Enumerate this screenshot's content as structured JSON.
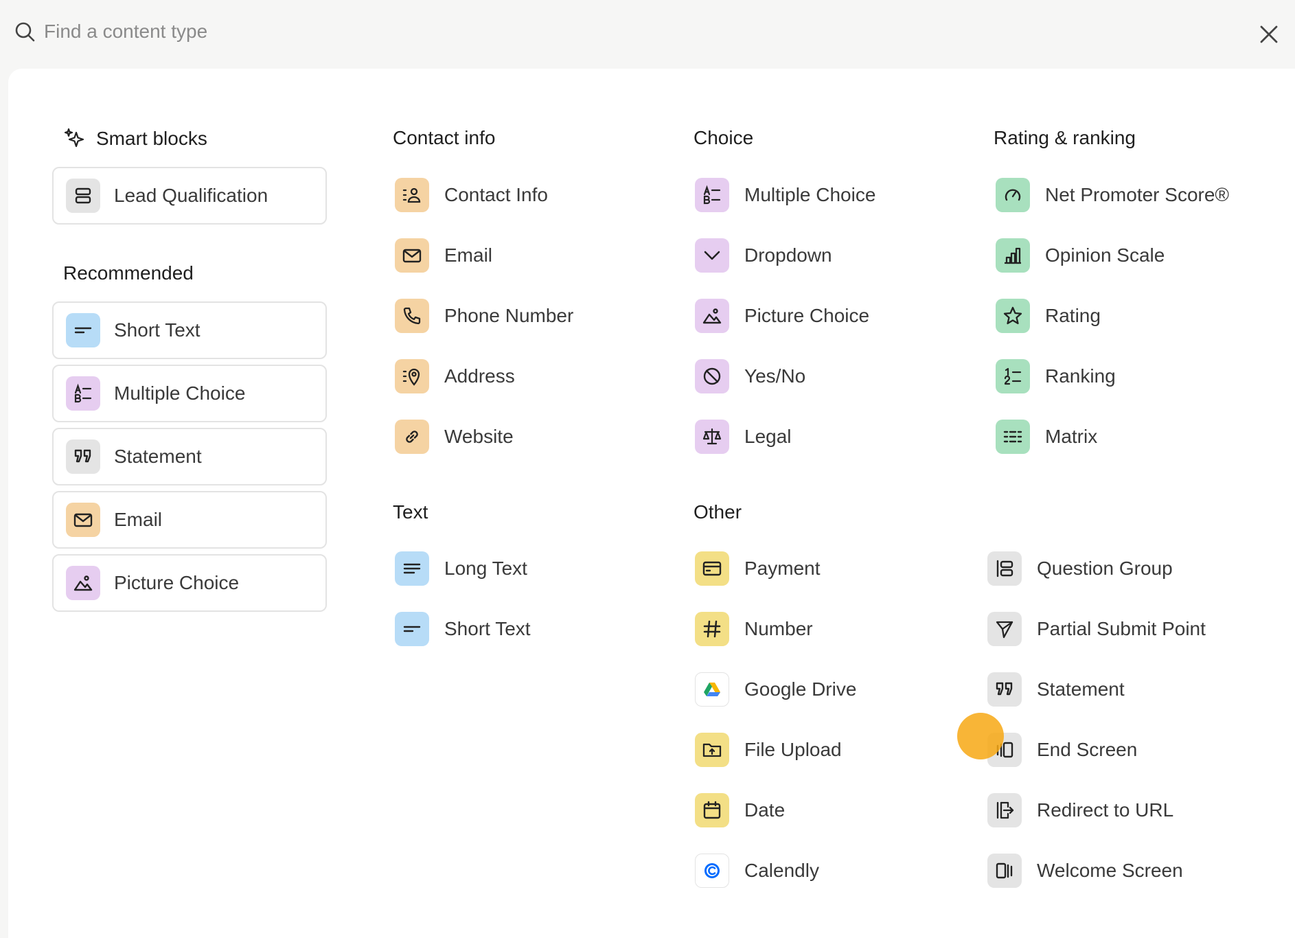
{
  "search": {
    "placeholder": "Find a content type"
  },
  "smart_blocks": {
    "heading": "Smart blocks",
    "items": [
      {
        "label": "Lead Qualification",
        "icon": "stack-icon"
      }
    ]
  },
  "recommended": {
    "heading": "Recommended",
    "items": [
      {
        "label": "Short Text",
        "icon": "short-text-icon"
      },
      {
        "label": "Multiple Choice",
        "icon": "multiple-choice-icon"
      },
      {
        "label": "Statement",
        "icon": "quote-icon"
      },
      {
        "label": "Email",
        "icon": "envelope-icon"
      },
      {
        "label": "Picture Choice",
        "icon": "picture-icon"
      }
    ]
  },
  "contact_info": {
    "heading": "Contact info",
    "items": [
      {
        "label": "Contact Info",
        "icon": "contact-card-icon"
      },
      {
        "label": "Email",
        "icon": "envelope-icon"
      },
      {
        "label": "Phone Number",
        "icon": "phone-icon"
      },
      {
        "label": "Address",
        "icon": "location-pin-icon"
      },
      {
        "label": "Website",
        "icon": "link-icon"
      }
    ]
  },
  "choice": {
    "heading": "Choice",
    "items": [
      {
        "label": "Multiple Choice",
        "icon": "multiple-choice-icon"
      },
      {
        "label": "Dropdown",
        "icon": "chevron-down-icon"
      },
      {
        "label": "Picture Choice",
        "icon": "picture-icon"
      },
      {
        "label": "Yes/No",
        "icon": "yes-no-icon"
      },
      {
        "label": "Legal",
        "icon": "scales-icon"
      }
    ]
  },
  "rating": {
    "heading": "Rating & ranking",
    "items": [
      {
        "label": "Net Promoter Score®",
        "icon": "gauge-icon"
      },
      {
        "label": "Opinion Scale",
        "icon": "bar-chart-icon"
      },
      {
        "label": "Rating",
        "icon": "star-icon"
      },
      {
        "label": "Ranking",
        "icon": "ranking-icon"
      },
      {
        "label": "Matrix",
        "icon": "matrix-icon"
      }
    ]
  },
  "text": {
    "heading": "Text",
    "items": [
      {
        "label": "Long Text",
        "icon": "long-text-icon"
      },
      {
        "label": "Short Text",
        "icon": "short-text-icon"
      }
    ]
  },
  "other": {
    "heading": "Other",
    "items": [
      {
        "label": "Payment",
        "icon": "credit-card-icon"
      },
      {
        "label": "Number",
        "icon": "hash-icon"
      },
      {
        "label": "Google Drive",
        "icon": "google-drive-icon"
      },
      {
        "label": "File Upload",
        "icon": "folder-upload-icon"
      },
      {
        "label": "Date",
        "icon": "calendar-icon"
      },
      {
        "label": "Calendly",
        "icon": "calendly-icon"
      }
    ],
    "items_right": [
      {
        "label": "Question Group",
        "icon": "question-group-icon"
      },
      {
        "label": "Partial Submit Point",
        "icon": "send-icon"
      },
      {
        "label": "Statement",
        "icon": "quote-icon"
      },
      {
        "label": "End Screen",
        "icon": "end-screen-icon"
      },
      {
        "label": "Redirect to URL",
        "icon": "redirect-icon"
      },
      {
        "label": "Welcome Screen",
        "icon": "welcome-screen-icon"
      }
    ]
  },
  "colors": {
    "background": "#f6f6f5",
    "panel": "#ffffff",
    "gray": "#e4e4e4",
    "blue": "#b7dcf7",
    "purple": "#e6cdf0",
    "orange": "#f5d3a3",
    "green": "#a8e0be",
    "yellow": "#f3df86",
    "cursor": "#f7a814"
  }
}
